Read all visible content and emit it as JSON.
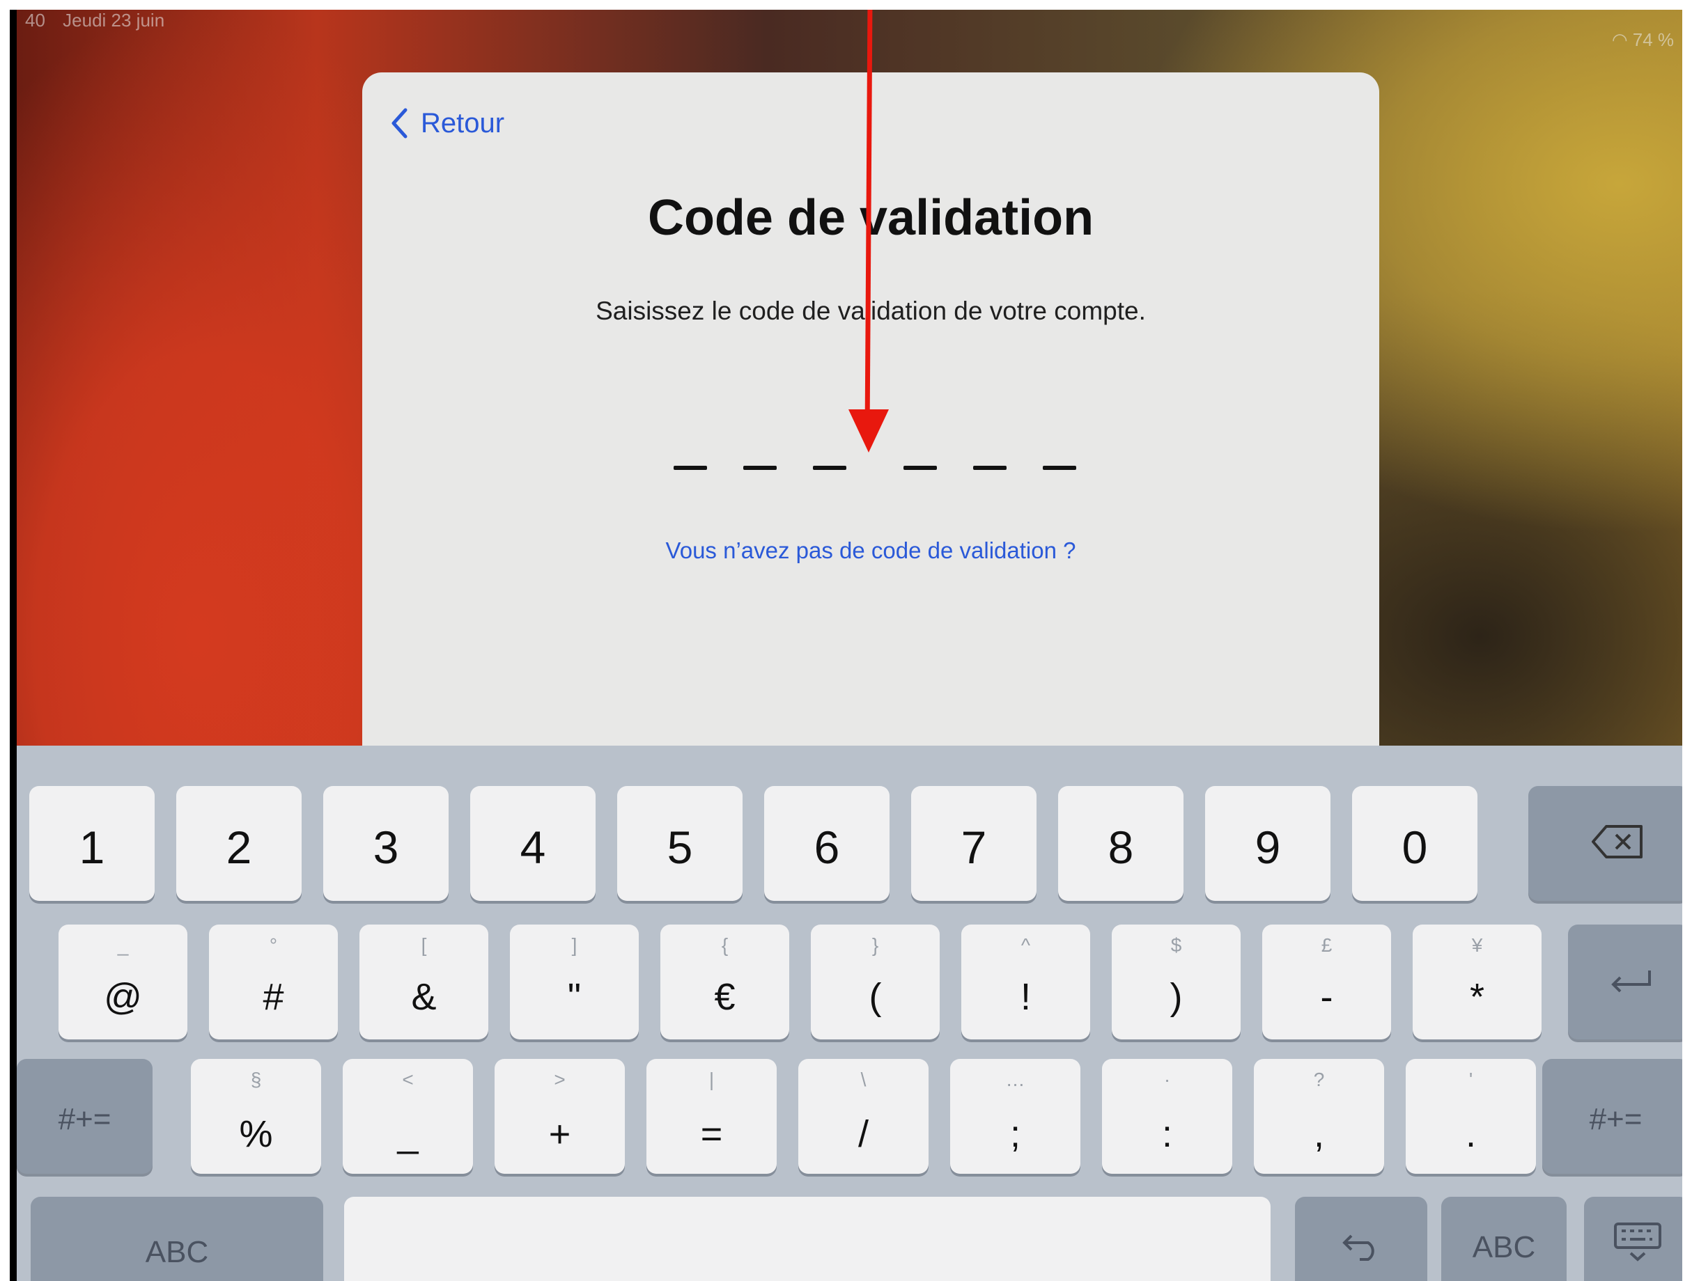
{
  "status_bar": {
    "time": "40",
    "date": "Jeudi 23 juin",
    "battery": "74 %"
  },
  "sheet": {
    "back_label": "Retour",
    "title": "Code de validation",
    "subtitle": "Saisissez le code de validation de votre compte.",
    "code_slots": 6,
    "help_link": "Vous n’avez pas de code de validation ?"
  },
  "keyboard": {
    "row1": [
      "1",
      "2",
      "3",
      "4",
      "5",
      "6",
      "7",
      "8",
      "9",
      "0"
    ],
    "row2": [
      {
        "main": "@",
        "alt": "_"
      },
      {
        "main": "#",
        "alt": "°"
      },
      {
        "main": "&",
        "alt": "["
      },
      {
        "main": "\"",
        "alt": "]"
      },
      {
        "main": "€",
        "alt": "{"
      },
      {
        "main": "(",
        "alt": "}"
      },
      {
        "main": "!",
        "alt": "^"
      },
      {
        "main": ")",
        "alt": "$"
      },
      {
        "main": "-",
        "alt": "£"
      },
      {
        "main": "*",
        "alt": "¥"
      }
    ],
    "row3": [
      {
        "main": "%",
        "alt": "§"
      },
      {
        "main": "_",
        "alt": "<"
      },
      {
        "main": "+",
        "alt": ">"
      },
      {
        "main": "=",
        "alt": "|"
      },
      {
        "main": "/",
        "alt": "\\"
      },
      {
        "main": ";",
        "alt": "…"
      },
      {
        "main": ":",
        "alt": "·"
      },
      {
        "main": ",",
        "alt": "?"
      },
      {
        "main": ".",
        "alt": "'"
      }
    ],
    "more_symbols_label": "#+=",
    "abc_label": "ABC",
    "icons": [
      "delete-icon",
      "return-icon",
      "undo-icon",
      "keyboard-dismiss-icon"
    ]
  },
  "colors": {
    "accent": "#2a59d8",
    "arrow": "#e8180e"
  }
}
